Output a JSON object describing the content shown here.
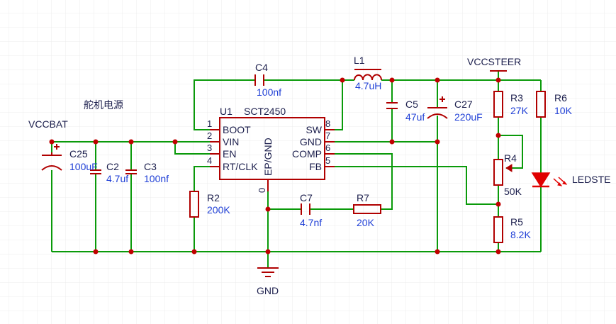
{
  "title_cn": "舵机电源",
  "nets": {
    "vccbat": "VCCBAT",
    "vccsteer": "VCCSTEER",
    "gnd": "GND"
  },
  "ic": {
    "ref": "U1",
    "part": "SCT2450",
    "ep_label": "EP/GND",
    "ep_pin": "0",
    "pins_left": [
      {
        "num": "1",
        "name": "BOOT"
      },
      {
        "num": "2",
        "name": "VIN"
      },
      {
        "num": "3",
        "name": "EN"
      },
      {
        "num": "4",
        "name": "RT/CLK"
      }
    ],
    "pins_right": [
      {
        "num": "8",
        "name": "SW"
      },
      {
        "num": "7",
        "name": "GND"
      },
      {
        "num": "6",
        "name": "COMP"
      },
      {
        "num": "5",
        "name": "FB"
      }
    ]
  },
  "components": {
    "c25": {
      "ref": "C25",
      "value": "100uF"
    },
    "c2": {
      "ref": "C2",
      "value": "4.7uf"
    },
    "c3": {
      "ref": "C3",
      "value": "100nf"
    },
    "c4": {
      "ref": "C4",
      "value": "100nf"
    },
    "l1": {
      "ref": "L1",
      "value": "4.7uH"
    },
    "c5": {
      "ref": "C5",
      "value": "47uf"
    },
    "c27": {
      "ref": "C27",
      "value": "220uF"
    },
    "r2": {
      "ref": "R2",
      "value": "200K"
    },
    "c7": {
      "ref": "C7",
      "value": "4.7nf"
    },
    "r7": {
      "ref": "R7",
      "value": "20K"
    },
    "r3": {
      "ref": "R3",
      "value": "27K"
    },
    "r4": {
      "ref": "R4",
      "value": "50K"
    },
    "r5": {
      "ref": "R5",
      "value": "8.2K"
    },
    "r6": {
      "ref": "R6",
      "value": "10K"
    },
    "led": {
      "ref": "LEDSTE"
    }
  },
  "colors": {
    "wire": "#0a9a0a",
    "component": "#b00000",
    "junction": "#c00000",
    "led": "#e00000",
    "label_blue": "#1f3fd6",
    "label_dark": "#1c1f4d",
    "grid": "#ececec"
  }
}
